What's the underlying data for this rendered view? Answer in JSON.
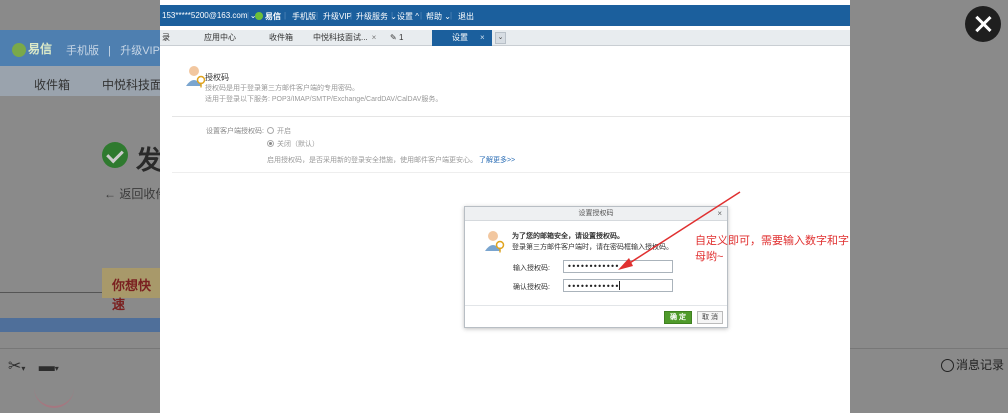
{
  "background": {
    "logo": "易信",
    "top_links": [
      "手机版",
      "升级VIP"
    ],
    "tabs": [
      "收件箱",
      "中悦科技面试"
    ],
    "heading": "发",
    "back_link": "← 返回收件",
    "banner": "你想快速",
    "message_log": "消息记录"
  },
  "topbar": {
    "account": "153*****5200@163.com ⌄",
    "logo": "易信",
    "mobile": "手机版",
    "vip": "升级VIP",
    "upgrade": "升级服务 ⌄",
    "settings": "设置 ^",
    "help": "帮助 ⌄",
    "logout": "退出"
  },
  "tabs": {
    "tab0": "录",
    "tab1": "应用中心",
    "tab2": "收件箱",
    "tab3": "中悦科技面试...",
    "tab4": "1",
    "tab5": "设置",
    "close": "×",
    "more": "⌄"
  },
  "auth": {
    "title": "授权码",
    "desc1": "授权码是用于登录第三方邮件客户端的专用密码。",
    "desc2": "适用于登录以下服务: POP3/IMAP/SMTP/Exchange/CardDAV/CalDAV服务。",
    "setting_label": "设置客户端授权码:",
    "option_on": "开启",
    "option_off": "关闭（默认）",
    "note": "启用授权码，是否采用新的登录安全措施，使用邮件客户端更安心。",
    "learn_more": "了解更多>>"
  },
  "modal": {
    "title": "设置授权码",
    "close": "×",
    "msg1": "为了您的邮箱安全，请设置授权码。",
    "msg2": "登录第三方邮件客户端时，请在密码框输入授权码。",
    "input_label": "输入授权码:",
    "input_value": "••••••••••••",
    "confirm_label": "确认授权码:",
    "confirm_value": "••••••••••••",
    "ok": "确 定",
    "cancel": "取 消"
  },
  "annotation": {
    "text": "自定义即可，需要输入数字和字母哟~",
    "color": "#e03030"
  },
  "colors": {
    "brand_blue": "#1b5f9d",
    "ok_green": "#4f9a2b"
  }
}
